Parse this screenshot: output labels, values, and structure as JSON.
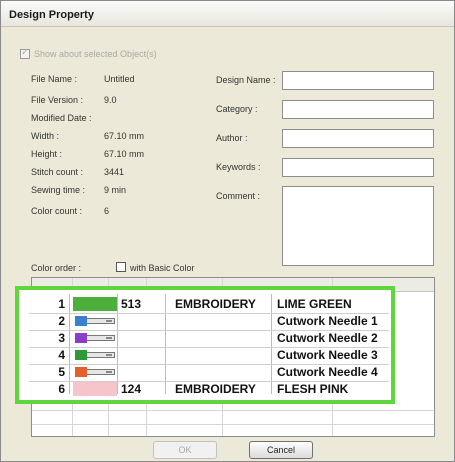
{
  "window": {
    "title": "Design Property"
  },
  "show_selected": {
    "label": "Show about selected Object(s)",
    "checked": true,
    "enabled": false
  },
  "info": {
    "labels": [
      "File Name :",
      "File Version :",
      "Modified Date :",
      "Width :",
      "Height :",
      "Stitch count :",
      "Sewing time :",
      "Color count :"
    ],
    "values": [
      "Untitled",
      "9.0",
      "",
      "67.10 mm",
      "67.10 mm",
      "3441",
      "9 min",
      "6"
    ]
  },
  "fields": {
    "design_name_label": "Design Name :",
    "category_label": "Category :",
    "author_label": "Author :",
    "keywords_label": "Keywords :",
    "comment_label": "Comment :",
    "design_name_value": "",
    "category_value": "",
    "author_value": "",
    "keywords_value": "",
    "comment_value": ""
  },
  "color_order": {
    "label": "Color order :",
    "with_basic_color_label": "with Basic Color",
    "with_basic_color_checked": false,
    "rows": [
      {
        "num": "1",
        "kind": "color",
        "color": "#4caf3a",
        "code": "513",
        "brand": "EMBROIDERY",
        "name": "LIME GREEN"
      },
      {
        "num": "2",
        "kind": "needle",
        "color": "#3a7fd0",
        "code": "",
        "brand": "",
        "name": "Cutwork Needle 1"
      },
      {
        "num": "3",
        "kind": "needle",
        "color": "#8a3ec7",
        "code": "",
        "brand": "",
        "name": "Cutwork Needle 2"
      },
      {
        "num": "4",
        "kind": "needle",
        "color": "#2e9a3a",
        "code": "",
        "brand": "",
        "name": "Cutwork Needle 3"
      },
      {
        "num": "5",
        "kind": "needle",
        "color": "#e0612a",
        "code": "",
        "brand": "",
        "name": "Cutwork Needle 4"
      },
      {
        "num": "6",
        "kind": "color",
        "color": "#f6c5cc",
        "code": "124",
        "brand": "EMBROIDERY",
        "name": "FLESH PINK"
      }
    ]
  },
  "buttons": {
    "ok": "OK",
    "cancel": "Cancel"
  },
  "colors": {
    "highlight_border": "#5fd53e",
    "dialog_bg": "#ece9d8"
  }
}
